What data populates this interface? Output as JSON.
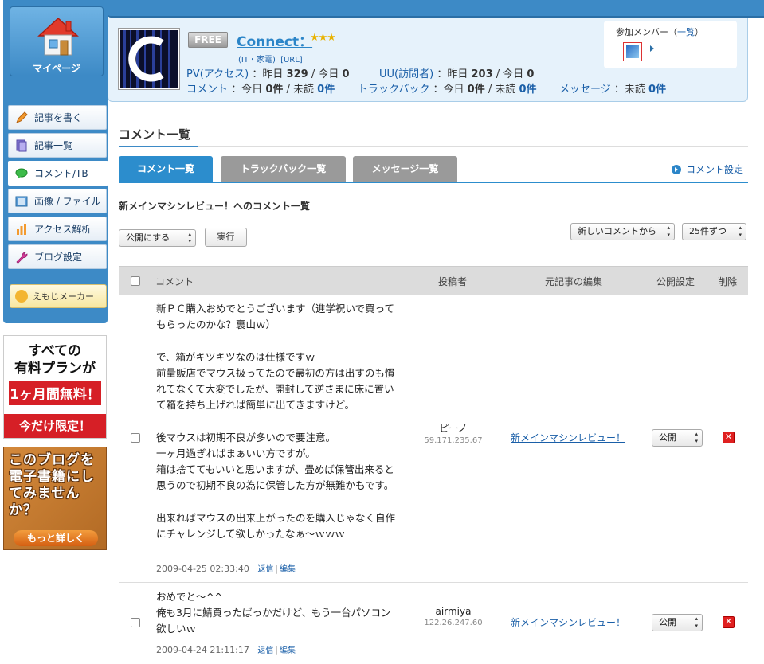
{
  "sidebar": {
    "mypage_label": "マイページ",
    "items": [
      {
        "label": "記事を書く",
        "icon": "pencil-icon"
      },
      {
        "label": "記事一覧",
        "icon": "document-list-icon"
      },
      {
        "label": "コメント/TB",
        "icon": "speech-bubble-icon"
      },
      {
        "label": "画像 / ファイル",
        "icon": "image-file-icon"
      },
      {
        "label": "アクセス解析",
        "icon": "bar-chart-icon"
      },
      {
        "label": "ブログ設定",
        "icon": "wrench-icon"
      }
    ],
    "emoji_maker_label": "えもじメーカー",
    "ad1": {
      "line1": "すべての",
      "line2": "有料プランが",
      "line3": "1ヶ月間無料！",
      "line4": "今だけ限定！"
    },
    "ad2": {
      "text": "このブログを電子書籍にしてみませんか？",
      "button": "もっと詳しく"
    }
  },
  "blog": {
    "plan_badge": "FREE",
    "title": "Connect：",
    "stars": "★★★",
    "category": "(IT・家電)",
    "url_link": "[URL]",
    "stats": {
      "pv_label": "PV(アクセス)",
      "pv_yesterday_label": "：昨日",
      "pv_yesterday": "329",
      "pv_today_label": "/ 今日",
      "pv_today": "0",
      "uu_label": "UU(訪問者)",
      "uu_yesterday_label": "：昨日",
      "uu_yesterday": "203",
      "uu_today_label": "/ 今日",
      "uu_today": "0",
      "comment_label": "コメント",
      "comment_today_label": "：今日",
      "comment_today": "0件",
      "comment_unread_label": "/ 未読",
      "comment_unread": "0件",
      "tb_label": "トラックバック",
      "tb_today_label": "：今日",
      "tb_today": "0件",
      "tb_unread_label": "/ 未読",
      "tb_unread": "0件",
      "msg_label": "メッセージ",
      "msg_unread_label": "：未読",
      "msg_unread": "0件"
    },
    "members_title": "参加メンバー（",
    "members_link": "一覧",
    "members_close": "）"
  },
  "main": {
    "section_title": "コメント一覧",
    "tabs": [
      {
        "label": "コメント一覧",
        "active": true
      },
      {
        "label": "トラックバック一覧",
        "active": false
      },
      {
        "label": "メッセージ一覧",
        "active": false
      }
    ],
    "comment_settings_link": "コメント設定",
    "list_title": "新メインマシンレビュー！へのコメント一覧",
    "bulk_action_value": "公開にする",
    "execute_label": "実行",
    "sort_value": "新しいコメントから",
    "per_page_value": "25件ずつ",
    "table": {
      "headers": {
        "comment": "コメント",
        "poster": "投稿者",
        "article": "元記事の編集",
        "publish": "公開設定",
        "delete": "削除"
      },
      "rows": [
        {
          "text": "新ＰＣ購入おめでとうございます（進学祝いで買ってもらったのかな？裏山ｗ）\n\nで、箱がキツキツなのは仕様ですｗ\n前量販店でマウス扱ってたので最初の方は出すのも慣れてなくて大変でしたが、開封して逆さまに床に置いて箱を持ち上げれば簡単に出てきますけど。\n\n後マウスは初期不良が多いので要注意。\n一ヶ月過ぎればまぁいい方ですが。\n箱は捨ててもいいと思いますが、畳めば保管出来ると思うので初期不良の為に保管した方が無難かもです。\n\n出来ればマウスの出来上がったのを購入じゃなく自作にチャレンジして欲しかったなぁ～ｗｗｗ",
          "date": "2009-04-25 02:33:40",
          "reply": "返信",
          "edit": "編集",
          "poster": "ピーノ",
          "ip": "59.171.235.67",
          "article": "新メインマシンレビュー！",
          "publish": "公開"
        },
        {
          "text": "おめでと～^^\n俺も3月に鯖買ったばっかだけど、もう一台パソコン欲しいｗ",
          "date": "2009-04-24 21:11:17",
          "reply": "返信",
          "edit": "編集",
          "poster": "airmiya",
          "ip": "122.26.247.60",
          "article": "新メインマシンレビュー！",
          "publish": "公開"
        }
      ]
    }
  }
}
